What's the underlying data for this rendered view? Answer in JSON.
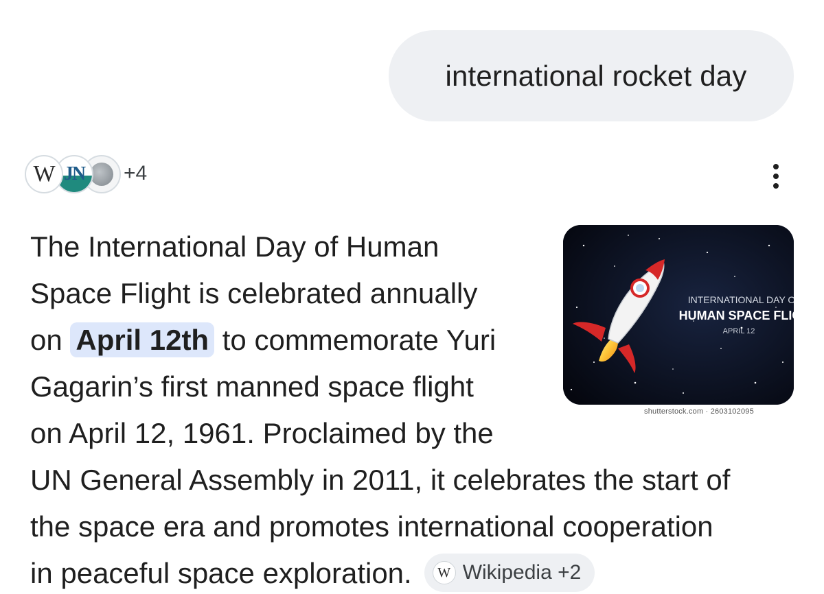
{
  "query": {
    "text": "international rocket day"
  },
  "sources": {
    "avatar_1_label": "W",
    "avatar_2_label": "JN",
    "more_count": "+4"
  },
  "answer": {
    "line1": "The International Day of Human",
    "line2": "Space Flight is celebrated annually",
    "line3_pre": "on ",
    "line3_highlight": "April 12th",
    "line3_post": " to commemorate Yuri",
    "line4": "Gagarin’s first manned space flight",
    "line5": "on April 12, 1961. Proclaimed by the",
    "line6": "UN General Assembly in 2011, it celebrates the start of",
    "line7": "the space era and promotes international cooperation",
    "line8": "in peaceful space exploration."
  },
  "citation": {
    "icon_letter": "W",
    "label": "Wikipedia +2"
  },
  "image": {
    "title_line1": "INTERNATIONAL DAY O",
    "title_line2": "HUMAN SPACE FLIG",
    "date": "APRIL 12",
    "watermark": "shutterstock.com · 2603102095"
  },
  "colors": {
    "bubble_bg": "#eef0f3",
    "highlight_bg": "#dde7fb",
    "rocket_red": "#d62828",
    "space_bg": "#0b1020"
  },
  "icons": {
    "menu": "more-vert-icon",
    "source_1": "wikipedia-logo",
    "source_2": "jn-logo",
    "source_3": "globe-icon"
  }
}
